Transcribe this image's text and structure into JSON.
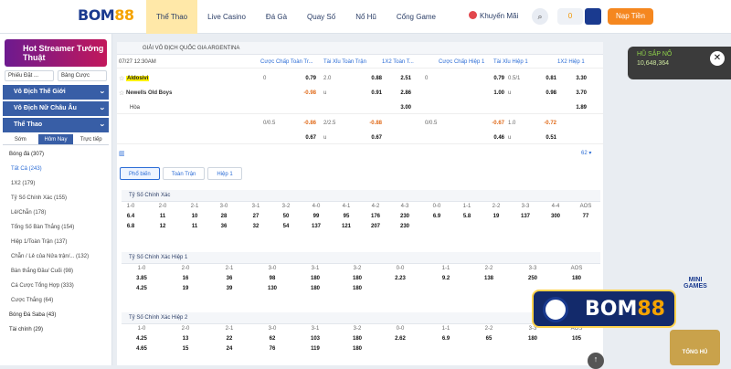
{
  "header": {
    "logo_main": "BOM",
    "logo_accent": "88",
    "nav": [
      "Thể Thao",
      "Live Casino",
      "Đá Gà",
      "Quay Số",
      "Nổ Hũ",
      "Cổng Game"
    ],
    "promo": "Khuyến Mãi",
    "balance": "0",
    "deposit": "Nạp Tiền"
  },
  "sidebar": {
    "banner": "Hot Streamer Tướng Thuật",
    "odds_format": "Phiếu Đặt ...",
    "bet_list": "Bảng Cược",
    "groups": [
      "Vô Địch Thế Giới",
      "Vô Địch Nữ Châu Âu",
      "Thể Thao"
    ],
    "tabs": [
      "Sớm",
      "Hôm Nay",
      "Trực tiếp"
    ],
    "football": "Bóng đá (307)",
    "items": [
      "Tất Cả (243)",
      "1X2 (179)",
      "Tỷ Số Chính Xác (155)",
      "Lẻ/Chẵn (178)",
      "Tổng Số Bàn Thắng (154)",
      "Hiệp 1/Toàn Trận (137)",
      "Chẵn / Lẻ của Nửa trận/... (132)",
      "Bàn thắng Đầu/ Cuối (98)",
      "Cá Cược Tổng Hợp (333)",
      "Cược Thắng (64)"
    ],
    "others": [
      "Bóng Đá Saba (43)",
      "Tài chính (29)"
    ]
  },
  "league": "GIẢI VÔ ĐỊCH QUỐC GIA ARGENTINA",
  "match": {
    "datetime": "07/27 12:30AM",
    "home": "Aldosivi",
    "away": "Newells Old Boys",
    "draw": "Hòa",
    "market_headers": [
      "Cược Chấp Toàn Tr...",
      "Tài Xỉu Toàn Trận",
      "1X2 Toàn T...",
      "Cược Chấp Hiệp 1",
      "Tài Xỉu Hiệp 1",
      "1X2 Hiệp 1"
    ],
    "rows": [
      [
        "0",
        "0.79",
        "2.0",
        "0.88",
        "2.51",
        "0",
        "0.79",
        "0.5/1",
        "0.81",
        "3.30"
      ],
      [
        "",
        "-0.98",
        "u",
        "0.91",
        "2.86",
        "",
        "1.00",
        "u",
        "0.98",
        "3.70"
      ],
      [
        "",
        "",
        "",
        "",
        "3.00",
        "",
        "",
        "",
        "",
        "1.89"
      ],
      [
        "0/0.5",
        "-0.86",
        "2/2.5",
        "-0.88",
        "",
        "0/0.5",
        "-0.67",
        "1.0",
        "-0.72",
        ""
      ],
      [
        "",
        "0.67",
        "u",
        "0.67",
        "",
        "",
        "0.46",
        "u",
        "0.51",
        ""
      ]
    ],
    "more_count": "62"
  },
  "detail_tabs": [
    "Phổ biến",
    "Toàn Trận",
    "Hiệp 1"
  ],
  "sections": [
    {
      "title": "Tỷ Số Chính Xác",
      "rows": [
        [
          "1-0",
          "2-0",
          "2-1",
          "3-0",
          "3-1",
          "3-2",
          "4-0",
          "4-1",
          "4-2",
          "4-3",
          "",
          "0-0",
          "1-1",
          "2-2",
          "3-3",
          "4-4",
          "AOS"
        ],
        [
          "6.4",
          "11",
          "10",
          "28",
          "27",
          "50",
          "99",
          "95",
          "176",
          "230",
          "",
          "6.9",
          "5.8",
          "19",
          "137",
          "300",
          "77"
        ],
        [
          "6.8",
          "12",
          "11",
          "36",
          "32",
          "54",
          "137",
          "121",
          "207",
          "230",
          "",
          "",
          "",
          "",
          "",
          "",
          ""
        ]
      ]
    },
    {
      "title": "Tỷ Số Chính Xác Hiệp 1",
      "rows": [
        [
          "1-0",
          "2-0",
          "2-1",
          "3-0",
          "3-1",
          "3-2",
          "0-0",
          "1-1",
          "2-2",
          "3-3",
          "AOS"
        ],
        [
          "3.85",
          "16",
          "36",
          "98",
          "180",
          "180",
          "2.23",
          "9.2",
          "138",
          "250",
          "180"
        ],
        [
          "4.25",
          "19",
          "39",
          "130",
          "180",
          "180",
          "",
          "",
          "",
          "",
          ""
        ]
      ]
    },
    {
      "title": "Tỷ Số Chính Xác Hiệp 2",
      "rows": [
        [
          "1-0",
          "2-0",
          "2-1",
          "3-0",
          "3-1",
          "3-2",
          "0-0",
          "1-1",
          "2-2",
          "3-3",
          "AOS"
        ],
        [
          "4.25",
          "13",
          "22",
          "62",
          "103",
          "180",
          "2.62",
          "6.9",
          "65",
          "180",
          "105"
        ],
        [
          "4.65",
          "15",
          "24",
          "76",
          "119",
          "180",
          "",
          "",
          "",
          "",
          ""
        ]
      ]
    }
  ],
  "right": {
    "jackpot_title": "HŨ SẮP NỔ",
    "jackpot_value": "10,648,364",
    "mini_games": "MINI GAMES",
    "badge_main": "BOM",
    "badge_accent": "88",
    "bottom_promo": "TỐNG HỦ"
  }
}
